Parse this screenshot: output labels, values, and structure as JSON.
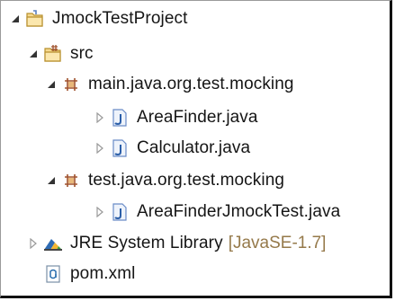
{
  "tree": {
    "project": {
      "label": "JmockTestProject",
      "expanded": true,
      "icon": "project-folder-icon"
    },
    "src": {
      "label": "src",
      "expanded": true,
      "icon": "source-folder-icon"
    },
    "main_package": {
      "label": "main.java.org.test.mocking",
      "expanded": true,
      "icon": "package-icon",
      "files": [
        {
          "label": "AreaFinder.java",
          "icon": "java-file-icon"
        },
        {
          "label": "Calculator.java",
          "icon": "java-file-icon"
        }
      ]
    },
    "test_package": {
      "label": "test.java.org.test.mocking",
      "expanded": true,
      "icon": "package-icon",
      "files": [
        {
          "label": "AreaFinderJmockTest.java",
          "icon": "java-file-icon"
        }
      ]
    },
    "jre": {
      "label": "JRE System Library",
      "decoration": "[JavaSE-1.7]",
      "expanded": false,
      "icon": "library-icon"
    },
    "pom": {
      "label": "pom.xml",
      "icon": "xml-file-icon"
    }
  },
  "colors": {
    "twisty_expanded": "#333333",
    "twisty_collapsed": "#999999",
    "decoration": "#95794a",
    "package": "#a0522d",
    "java_file": "#2b5ea8"
  }
}
